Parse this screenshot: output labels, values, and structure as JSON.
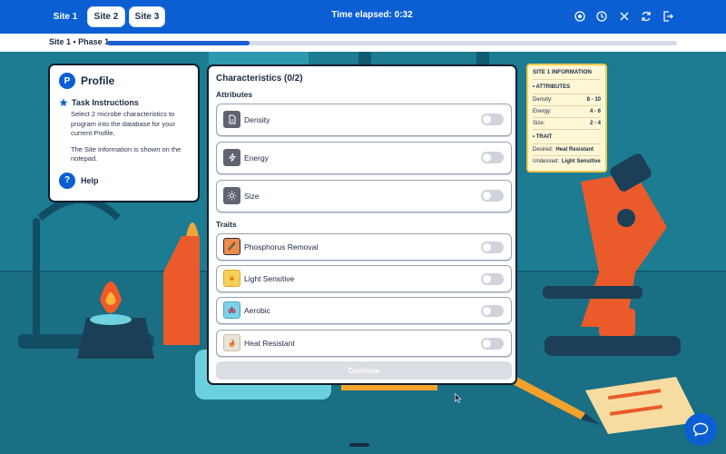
{
  "topbar": {
    "tabs": [
      {
        "label": "Site 1",
        "active": true
      },
      {
        "label": "Site 2",
        "active": false
      },
      {
        "label": "Site 3",
        "active": false
      }
    ],
    "time_label": "Time elapsed: 0:32",
    "icons": [
      "target-icon",
      "clock-icon",
      "close-icon",
      "refresh-icon",
      "exit-icon"
    ],
    "accent_color": "#0b5fd3"
  },
  "progress": {
    "label": "Site 1 • Phase 1",
    "fraction": 0.25
  },
  "profile": {
    "badge": "P",
    "title": "Profile",
    "task_title": "Task Instructions",
    "task_text_1": "Select 2 microbe characteristics to program into the database for your current Profile.",
    "task_text_2": "The Site information is shown on the notepad.",
    "help_badge": "?",
    "help_label": "Help"
  },
  "characteristics": {
    "title": "Characteristics (0/2)",
    "attributes_header": "Attributes",
    "attributes": [
      {
        "label": "Density",
        "icon": "document-icon",
        "on": false
      },
      {
        "label": "Energy",
        "icon": "lightning-icon",
        "on": false
      },
      {
        "label": "Size",
        "icon": "sun-icon",
        "on": false
      }
    ],
    "traits_header": "Traits",
    "traits": [
      {
        "label": "Phosphorus Removal",
        "icon": "test-tube-icon",
        "on": false
      },
      {
        "label": "Light Sensitive",
        "icon": "sun-face-icon",
        "on": false
      },
      {
        "label": "Aerobic",
        "icon": "lungs-icon",
        "on": false
      },
      {
        "label": "Heat Resistant",
        "icon": "flame-icon",
        "on": false
      }
    ],
    "continue_label": "Continue"
  },
  "site_info": {
    "title": "SITE 1 INFORMATION",
    "attributes_header": "• ATTRIBUTES",
    "attributes": [
      {
        "label": "Density:",
        "value": "8 - 10"
      },
      {
        "label": "Energy:",
        "value": "4 - 6"
      },
      {
        "label": "Size:",
        "value": "2 - 4"
      }
    ],
    "trait_header": "• TRAIT",
    "desired_label": "Desired:",
    "desired_value": "Heat Resistant",
    "undesired_label": "Undesired:",
    "undesired_value": "Light Sensitive"
  }
}
